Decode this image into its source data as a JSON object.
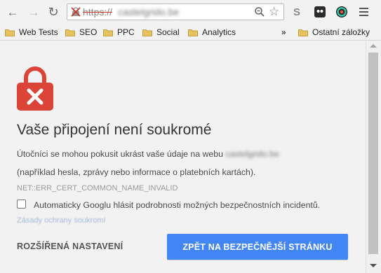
{
  "toolbar": {
    "back_icon": "arrow-left-icon",
    "forward_icon": "arrow-right-icon",
    "reload_icon": "reload-icon",
    "url_scheme": "https://",
    "url_host": "castelgrido.be",
    "zoom_icon": "zoom-icon",
    "star_icon": "star-icon",
    "extension_s_label": "S",
    "menu_icon": "hamburger-menu-icon"
  },
  "bookmarks": {
    "items": [
      {
        "label": "Web Tests"
      },
      {
        "label": "SEO"
      },
      {
        "label": "PPC"
      },
      {
        "label": "Social"
      },
      {
        "label": "Analytics"
      }
    ],
    "overflow_label": "»",
    "other_label": "Ostatní záložky"
  },
  "error_page": {
    "heading": "Vaše připojení není soukromé",
    "body_prefix": "Útočníci se mohou pokusit ukrást vaše údaje na webu",
    "body_host": "castelgrido.be",
    "body_line2": "(například hesla, zprávy nebo informace o platebních kartách).",
    "error_code": "NET::ERR_CERT_COMMON_NAME_INVALID",
    "checkbox_label": "Automaticky Googlu hlásit podrobnosti možných bezpečnostních incidentů.",
    "checkbox_checked": false,
    "policy_link": "Zásady ochrany soukromí",
    "advanced_label": "ROZŠÍŘENÁ NASTAVENÍ",
    "back_button_label": "ZPĚT NA BEZPEČNĚJŠÍ STRÁNKU"
  },
  "colors": {
    "lock_red": "#db4437",
    "button_blue": "#4285f4",
    "folder_yellow": "#e8c25c"
  }
}
